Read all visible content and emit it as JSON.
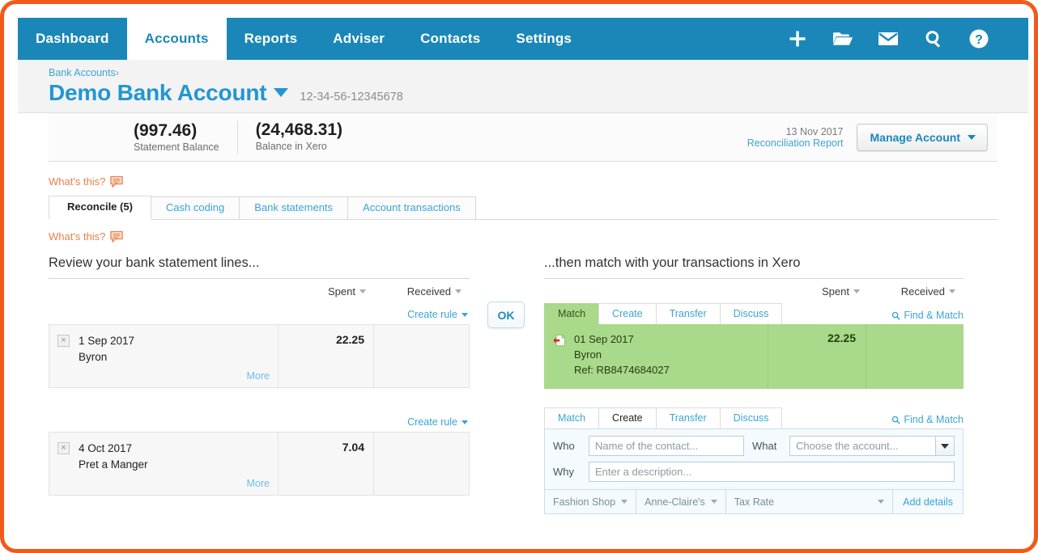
{
  "nav": {
    "tabs": [
      {
        "label": "Dashboard",
        "active": false
      },
      {
        "label": "Accounts",
        "active": true
      },
      {
        "label": "Reports",
        "active": false
      },
      {
        "label": "Adviser",
        "active": false
      },
      {
        "label": "Contacts",
        "active": false
      },
      {
        "label": "Settings",
        "active": false
      }
    ],
    "icons": [
      {
        "name": "plus-icon"
      },
      {
        "name": "folder-icon"
      },
      {
        "name": "envelope-icon"
      },
      {
        "name": "search-icon"
      },
      {
        "name": "help-icon"
      }
    ]
  },
  "header": {
    "breadcrumb": "Bank Accounts",
    "breadcrumb_separator": "›",
    "account_title": "Demo Bank Account",
    "account_number": "12-34-56-12345678"
  },
  "balances": {
    "statement": {
      "amount": "(997.46)",
      "label": "Statement Balance"
    },
    "xero": {
      "amount": "(24,468.31)",
      "label": "Balance in Xero"
    },
    "date": "13 Nov 2017",
    "report_link": "Reconciliation Report",
    "manage_button": "Manage Account"
  },
  "whats_this": "What's this?",
  "tabs": [
    {
      "label": "Reconcile (5)",
      "active": true
    },
    {
      "label": "Cash coding",
      "active": false
    },
    {
      "label": "Bank statements",
      "active": false
    },
    {
      "label": "Account transactions",
      "active": false
    }
  ],
  "left_panel": {
    "heading": "Review your bank statement lines...",
    "columns": {
      "spent": "Spent",
      "received": "Received"
    },
    "create_rule": "Create rule",
    "more": "More",
    "lines": [
      {
        "date": "1 Sep 2017",
        "payee": "Byron",
        "spent": "22.25",
        "received": ""
      },
      {
        "date": "4 Oct 2017",
        "payee": "Pret a Manger",
        "spent": "7.04",
        "received": ""
      }
    ]
  },
  "middle": {
    "ok_button": "OK"
  },
  "right_panel": {
    "heading": "...then match with your transactions in Xero",
    "columns": {
      "spent": "Spent",
      "received": "Received"
    },
    "find_match": "Find & Match",
    "blocks": [
      {
        "tabs": [
          {
            "label": "Match",
            "active": true
          },
          {
            "label": "Create",
            "active": false
          },
          {
            "label": "Transfer",
            "active": false
          },
          {
            "label": "Discuss",
            "active": false
          }
        ],
        "matched": {
          "date": "01 Sep 2017",
          "payee": "Byron",
          "reference": "Ref: RB8474684027",
          "spent": "22.25",
          "received": ""
        }
      },
      {
        "tabs": [
          {
            "label": "Match",
            "active": false
          },
          {
            "label": "Create",
            "active": true
          },
          {
            "label": "Transfer",
            "active": false
          },
          {
            "label": "Discuss",
            "active": false
          }
        ],
        "form": {
          "who_label": "Who",
          "who_placeholder": "Name of the contact...",
          "who_value": "",
          "what_label": "What",
          "what_placeholder": "Choose the account...",
          "what_value": "",
          "why_label": "Why",
          "why_placeholder": "Enter a description...",
          "why_value": "",
          "footer": {
            "region": "Fashion Shop",
            "tracking": "Anne-Claire's",
            "tax_rate": "Tax Rate",
            "add_details": "Add details"
          }
        }
      }
    ]
  },
  "colors": {
    "nav_blue": "#1b87b9",
    "link_blue": "#3ba4d4",
    "orange": "#e8804a",
    "frame_orange": "#f15a1a",
    "match_green": "#a9d98a"
  }
}
